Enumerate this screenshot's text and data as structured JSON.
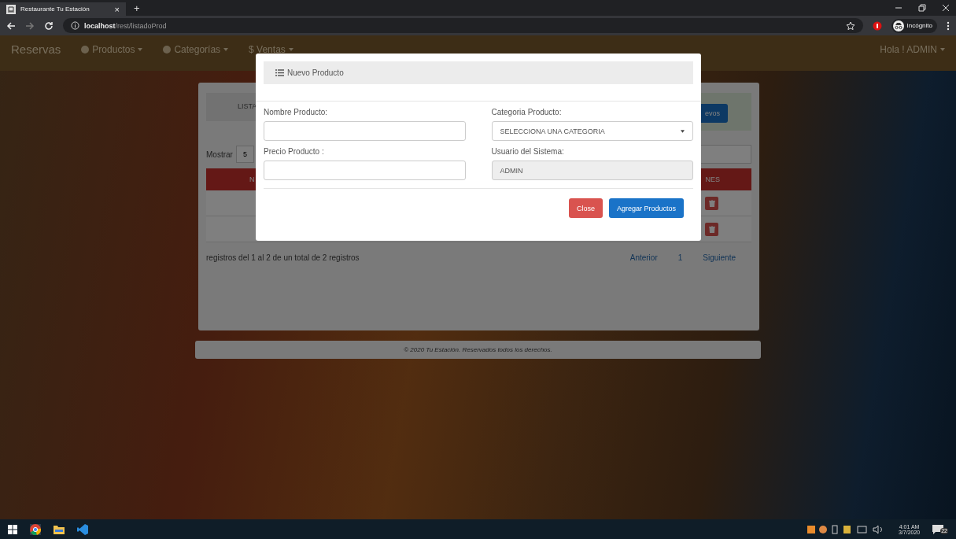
{
  "browser": {
    "tab_title": "Restaurante Tu Estación",
    "tab_close": "×",
    "new_tab": "+",
    "url_host": "localhost",
    "url_path": "/rest/listadoProd",
    "profile": "Incógnito"
  },
  "navbar": {
    "brand": "Reservas",
    "menus": [
      {
        "label": "Productos",
        "kind": "circle"
      },
      {
        "label": "Categorías",
        "kind": "circle"
      },
      {
        "label": "$ Ventas",
        "kind": "plain"
      }
    ],
    "user": "Hola ! ADMIN"
  },
  "panel": {
    "tab_label": "LISTA",
    "new_button": "evos",
    "show_label": "Mostrar",
    "page_size": "5",
    "columns": [
      "N",
      "NES"
    ],
    "rows": [
      {
        "kind": "trash"
      },
      {
        "kind": "trash"
      }
    ],
    "summary": "registros del 1 al 2 de un total de 2 registros",
    "pagination": [
      "Anterior",
      "1",
      "Siguiente"
    ]
  },
  "footer": "© 2020 Tu Estación. Reservados todos los derechos.",
  "modal": {
    "title": "Nuevo Producto",
    "fields": [
      {
        "label": "Nombre Producto:",
        "kind": "text"
      },
      {
        "label": "Categoria Producto:",
        "kind": "select",
        "value": "SELECCIONA UNA CATEGORIA"
      },
      {
        "label": "Precio Producto :",
        "kind": "text"
      },
      {
        "label": "Usuario del Sistema:",
        "kind": "readonly",
        "value": "ADMIN"
      }
    ],
    "buttons": [
      {
        "label": "Close",
        "kind": "danger"
      },
      {
        "label": "Agregar Productos",
        "kind": "primary"
      }
    ]
  },
  "taskbar": {
    "time": "4:01 AM",
    "date": "3/7/2020",
    "notifications": "22"
  }
}
